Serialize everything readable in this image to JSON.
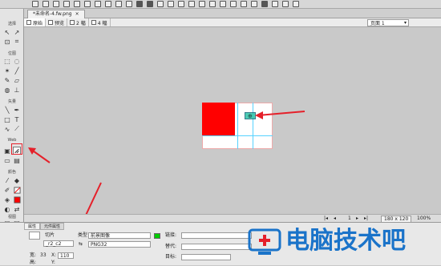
{
  "tools_panel": {
    "sections": [
      "选择",
      "位图",
      "矢量",
      "Web",
      "颜色",
      "视图"
    ]
  },
  "document": {
    "tab_title": "*未命名-4.fw.png"
  },
  "view_bar": {
    "original": "原始",
    "preview": "预览",
    "two_up": "2 幅",
    "four_up": "4 幅",
    "page": "页面 1"
  },
  "status_bar": {
    "page_number": "1",
    "canvas_size": "180 x 120",
    "zoom": "100%"
  },
  "properties": {
    "tabs": [
      "属性",
      "元件属性"
    ],
    "object_type": "切片",
    "slice_name": "_r2_c2",
    "type_label": "类型",
    "type_value": "前景图像",
    "format_value": "PNG32",
    "link_label": "链接:",
    "alt_label": "替代:",
    "target_label": "目标:",
    "w_label": "宽:",
    "w_value": "33",
    "x_label": "X:",
    "x_value": "110",
    "h_label": "高:",
    "y_label": "Y:"
  },
  "watermark": {
    "text": "电脑技术吧"
  },
  "colors": {
    "accent_red": "#e5202a",
    "canvas_red": "#ff0000",
    "slice_green": "#00cc00"
  }
}
